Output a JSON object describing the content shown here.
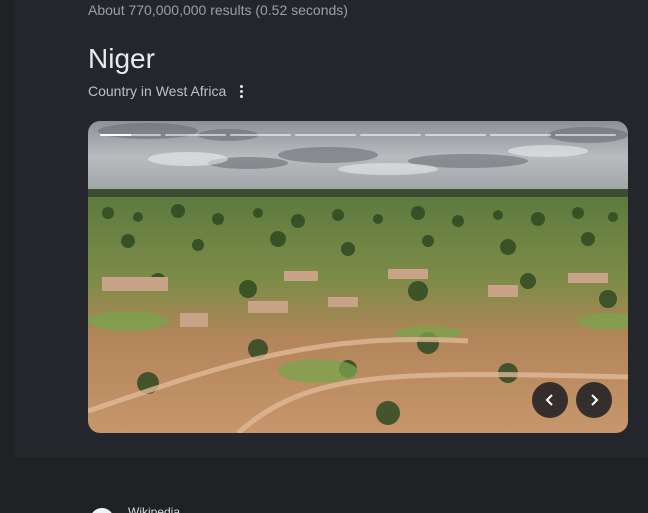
{
  "search": {
    "result_stats": "About 770,000,000 results (0.52 seconds)"
  },
  "entity": {
    "title": "Niger",
    "subtitle": "Country in West Africa",
    "more_icon": "more-vert-icon"
  },
  "carousel": {
    "photo_subject": "aerial-village-landscape",
    "segments": [
      {
        "fill": 0.5
      },
      {
        "fill": 0
      },
      {
        "fill": 0
      },
      {
        "fill": 0
      },
      {
        "fill": 0
      },
      {
        "fill": 0
      },
      {
        "fill": 0
      },
      {
        "fill": 0
      }
    ],
    "prev_icon": "chevron-left-icon",
    "next_icon": "chevron-right-icon"
  },
  "source": {
    "name": "Wikipedia",
    "logo_icon": "wikipedia-logo-icon"
  },
  "colors": {
    "background": "#202124",
    "panel": "#24262b",
    "primary_text": "#e8eaed",
    "secondary_text": "#9aa0a6"
  }
}
